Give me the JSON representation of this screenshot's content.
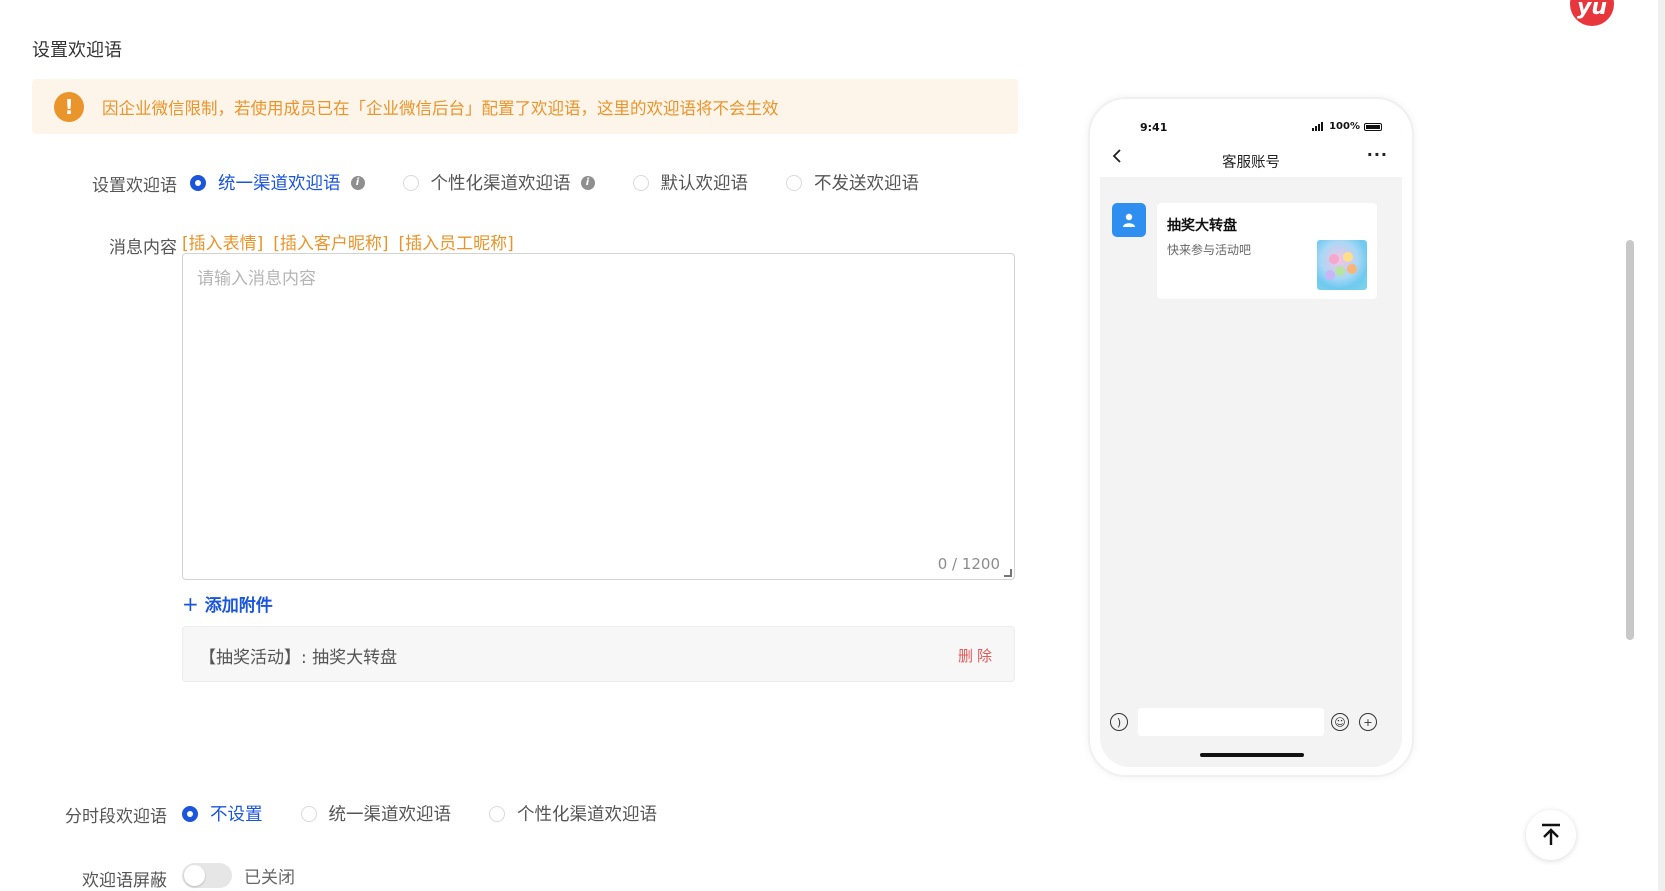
{
  "section_title": "设置欢迎语",
  "alert": {
    "text": "因企业微信限制，若使用成员已在「企业微信后台」配置了欢迎语，这里的欢迎语将不会生效"
  },
  "welcome_type": {
    "label": "设置欢迎语",
    "options": [
      {
        "label": "统一渠道欢迎语",
        "checked": true,
        "has_info": true
      },
      {
        "label": "个性化渠道欢迎语",
        "checked": false,
        "has_info": true
      },
      {
        "label": "默认欢迎语",
        "checked": false,
        "has_info": false
      },
      {
        "label": "不发送欢迎语",
        "checked": false,
        "has_info": false
      }
    ]
  },
  "message": {
    "label": "消息内容",
    "insert_emoji": "[插入表情]",
    "insert_customer_nickname": "[插入客户昵称]",
    "insert_employee_nickname": "[插入员工昵称]",
    "placeholder": "请输入消息内容",
    "value": "",
    "counter": "0 / 1200"
  },
  "attachment": {
    "add_label": "添加附件",
    "item_text": "【抽奖活动】: 抽奖大转盘",
    "delete_label": "删除"
  },
  "time_period": {
    "label": "分时段欢迎语",
    "options": [
      {
        "label": "不设置",
        "checked": true
      },
      {
        "label": "统一渠道欢迎语",
        "checked": false
      },
      {
        "label": "个性化渠道欢迎语",
        "checked": false
      }
    ]
  },
  "mask": {
    "label": "欢迎语屏蔽",
    "state_text": "已关闭",
    "enabled": false
  },
  "phone_preview": {
    "time": "9:41",
    "battery": "100%",
    "title": "客服账号",
    "card_title": "抽奖大转盘",
    "card_subtitle": "快来参与活动吧"
  },
  "brand_badge": "yu",
  "colors": {
    "primary": "#1a56db",
    "warning": "#e9952b",
    "danger": "#e05a5a",
    "alert_bg": "#fdf4ea"
  },
  "icons": [
    "warning-icon",
    "info-icon",
    "plus-icon",
    "back-chevron-icon",
    "more-icon",
    "user-icon",
    "voice-icon",
    "emoji-icon",
    "add-circle-icon",
    "back-to-top-icon"
  ]
}
